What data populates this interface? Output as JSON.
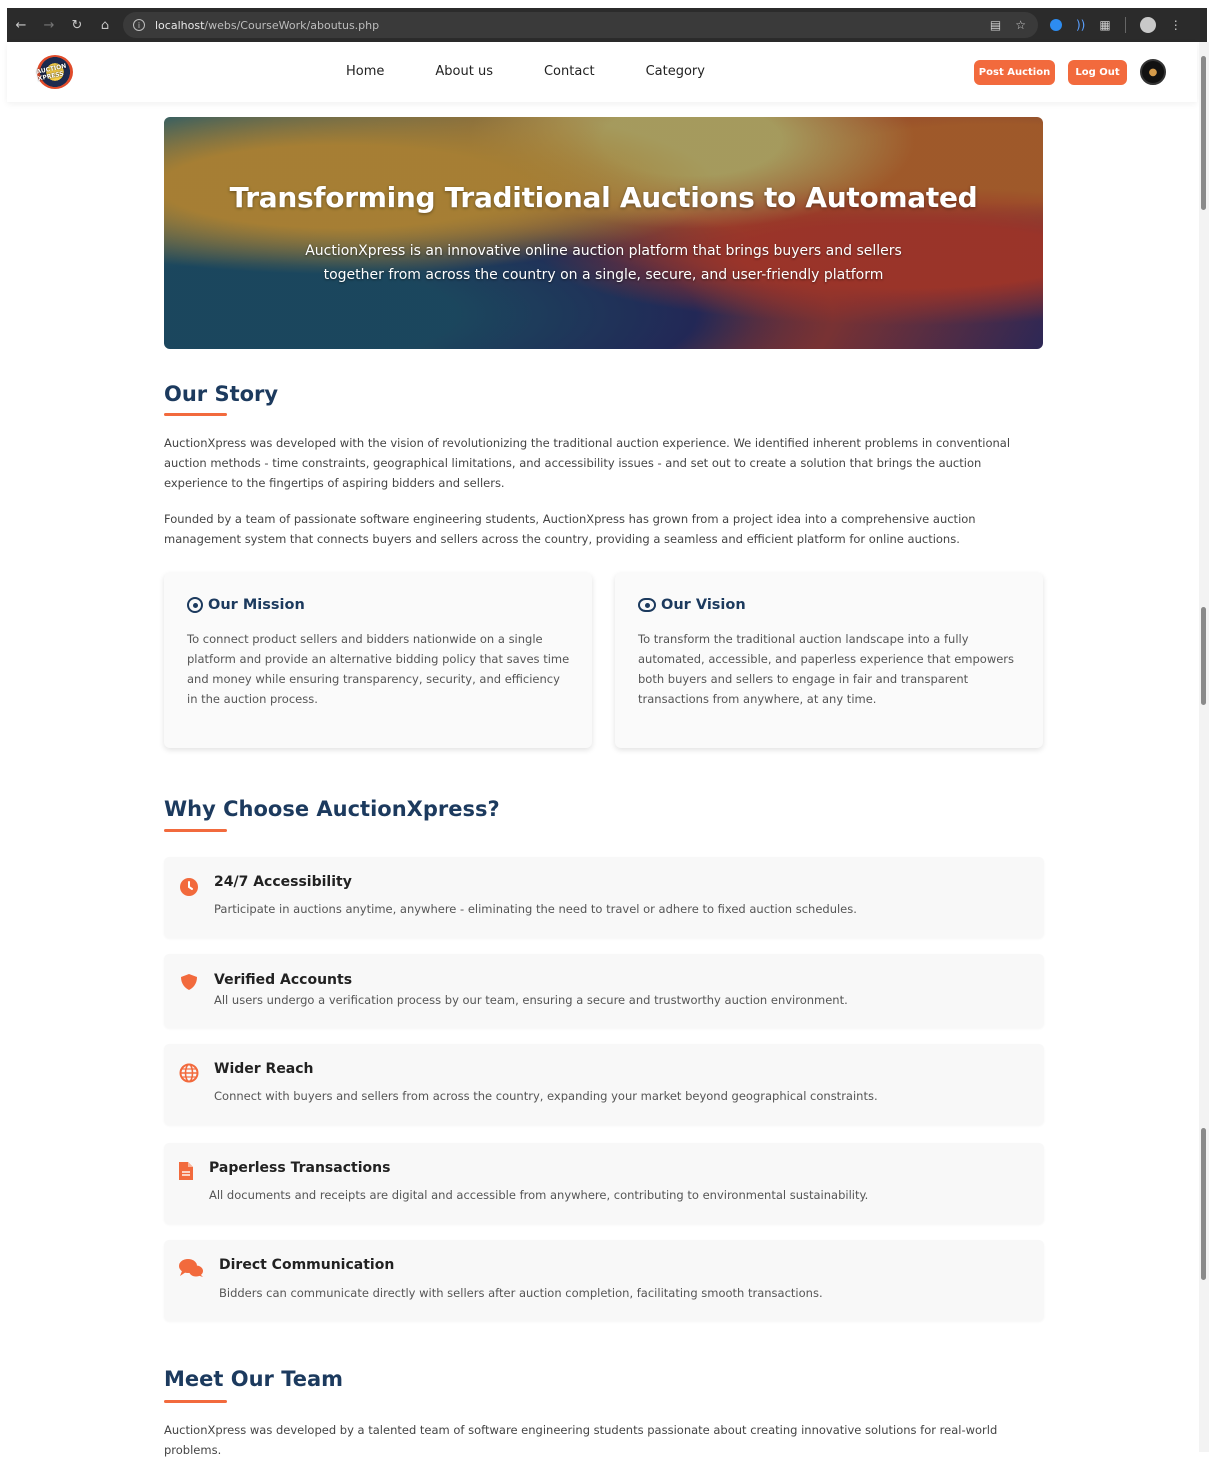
{
  "browser": {
    "url_host": "localhost",
    "url_path": "/webs/CourseWork/aboutus.php"
  },
  "header": {
    "logo_text": "AUCTION XPRESS",
    "nav": [
      {
        "label": "Home"
      },
      {
        "label": "About us"
      },
      {
        "label": "Contact"
      },
      {
        "label": "Category"
      }
    ],
    "post_auction_label": "Post Auction",
    "logout_label": "Log Out"
  },
  "hero": {
    "title": "Transforming Traditional Auctions to Automated",
    "subtitle": "AuctionXpress is an innovative online auction platform that brings buyers and sellers together from across the country on a single, secure, and user-friendly platform"
  },
  "story": {
    "title": "Our Story",
    "paragraphs": [
      "AuctionXpress was developed with the vision of revolutionizing the traditional auction experience. We identified inherent problems in conventional auction methods - time constraints, geographical limitations, and accessibility issues - and set out to create a solution that brings the auction experience to the fingertips of aspiring bidders and sellers.",
      "Founded by a team of passionate software engineering students, AuctionXpress has grown from a project idea into a comprehensive auction management system that connects buyers and sellers across the country, providing a seamless and efficient platform for online auctions."
    ]
  },
  "mission": {
    "title": "Our Mission",
    "text": "To connect product sellers and bidders nationwide on a single platform and provide an alternative bidding policy that saves time and money while ensuring transparency, security, and efficiency in the auction process."
  },
  "vision": {
    "title": "Our Vision",
    "text": "To transform the traditional auction landscape into a fully automated, accessible, and paperless experience that empowers both buyers and sellers to engage in fair and transparent transactions from anywhere, at any time."
  },
  "why": {
    "title": "Why Choose AuctionXpress?",
    "features": [
      {
        "title": "24/7 Accessibility",
        "text": "Participate in auctions anytime, anywhere - eliminating the need to travel or adhere to fixed auction schedules.",
        "icon": "clock-icon"
      },
      {
        "title": "Verified Accounts",
        "text": "All users undergo a verification process by our team, ensuring a secure and trustworthy auction environment.",
        "icon": "shield-icon"
      },
      {
        "title": "Wider Reach",
        "text": "Connect with buyers and sellers from across the country, expanding your market beyond geographical constraints.",
        "icon": "globe-icon"
      },
      {
        "title": "Paperless Transactions",
        "text": "All documents and receipts are digital and accessible from anywhere, contributing to environmental sustainability.",
        "icon": "document-icon"
      },
      {
        "title": "Direct Communication",
        "text": "Bidders can communicate directly with sellers after auction completion, facilitating smooth transactions.",
        "icon": "chat-icon"
      }
    ]
  },
  "team": {
    "title": "Meet Our Team",
    "text": "AuctionXpress was developed by a talented team of software engineering students passionate about creating innovative solutions for real-world problems."
  },
  "colors": {
    "accent": "#f26a3d",
    "heading": "#1c3a5e"
  }
}
